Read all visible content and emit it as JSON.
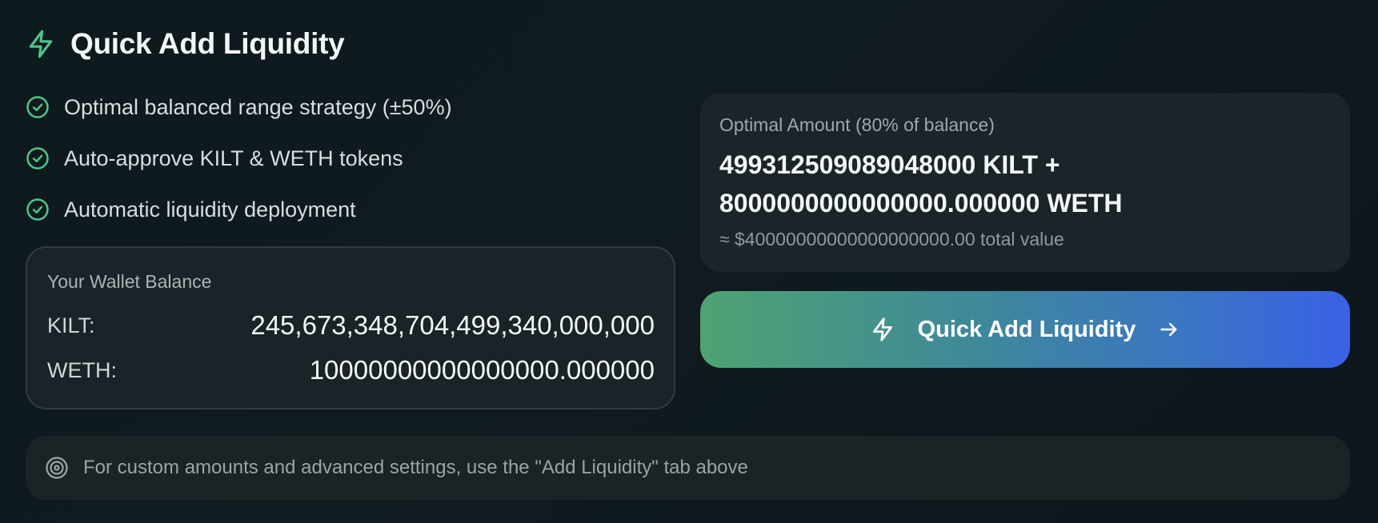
{
  "header": {
    "title": "Quick Add Liquidity",
    "icon": "lightning-icon"
  },
  "features": [
    {
      "icon": "check-circle-icon",
      "label": "Optimal balanced range strategy (±50%)"
    },
    {
      "icon": "check-circle-icon",
      "label": "Auto-approve KILT & WETH tokens"
    },
    {
      "icon": "check-circle-icon",
      "label": "Automatic liquidity deployment"
    }
  ],
  "wallet": {
    "title": "Your Wallet Balance",
    "rows": [
      {
        "label": "KILT:",
        "value": "245,673,348,704,499,340,000,000"
      },
      {
        "label": "WETH:",
        "value": "10000000000000000.000000"
      }
    ]
  },
  "optimal": {
    "label": "Optimal Amount (80% of balance)",
    "line1": "499312509089048000 KILT +",
    "line2": "8000000000000000.000000 WETH",
    "approx": "≈ $40000000000000000000.00 total value"
  },
  "cta": {
    "label": "Quick Add Liquidity",
    "left_icon": "lightning-icon",
    "right_icon": "arrow-right-icon"
  },
  "note": {
    "icon": "target-icon",
    "text": "For custom amounts and advanced settings, use the \"Add Liquidity\" tab above"
  },
  "colors": {
    "accent_green": "#4fc48a",
    "gradient_start": "#4ea372",
    "gradient_end": "#3a61e6"
  }
}
